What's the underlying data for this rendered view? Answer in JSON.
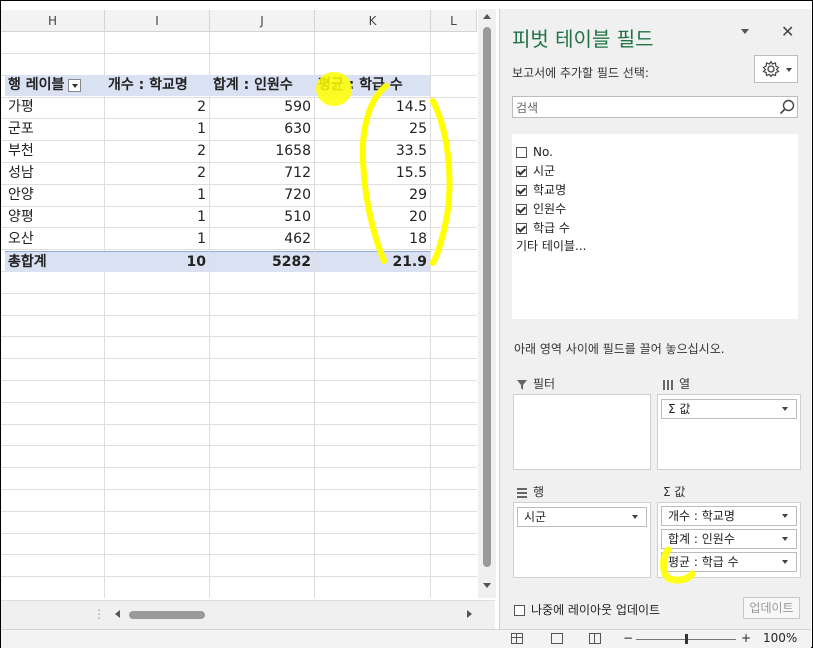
{
  "sheet": {
    "columns": [
      "H",
      "I",
      "J",
      "K",
      "L"
    ],
    "pivot_header": {
      "row_label": "행 레이블",
      "col1": "개수 : 학교명",
      "col2": "합계 : 인원수",
      "col3": "평균 : 학급 수"
    },
    "rows": [
      {
        "label": "가평",
        "v1": "2",
        "v2": "590",
        "v3": "14.5"
      },
      {
        "label": "군포",
        "v1": "1",
        "v2": "630",
        "v3": "25"
      },
      {
        "label": "부천",
        "v1": "2",
        "v2": "1658",
        "v3": "33.5"
      },
      {
        "label": "성남",
        "v1": "2",
        "v2": "712",
        "v3": "15.5"
      },
      {
        "label": "안양",
        "v1": "1",
        "v2": "720",
        "v3": "29"
      },
      {
        "label": "양평",
        "v1": "1",
        "v2": "510",
        "v3": "20"
      },
      {
        "label": "오산",
        "v1": "1",
        "v2": "462",
        "v3": "18"
      }
    ],
    "total": {
      "label": "총합계",
      "v1": "10",
      "v2": "5282",
      "v3": "21.9"
    }
  },
  "pane": {
    "title": "피벗 테이블 필드",
    "choose_label": "보고서에 추가할 필드 선택:",
    "search_placeholder": "검색",
    "fields": [
      {
        "label": "No.",
        "checked": false
      },
      {
        "label": "시군",
        "checked": true
      },
      {
        "label": "학교명",
        "checked": true
      },
      {
        "label": "인원수",
        "checked": true
      },
      {
        "label": "학급 수",
        "checked": true
      }
    ],
    "more_tables": "기타 테이블...",
    "drag_note": "아래 영역 사이에 필드를 끌어 놓으십시오.",
    "areas": {
      "filter_label": "필터",
      "columns_label": "열",
      "columns_chip": "Σ 값",
      "rows_label": "행",
      "rows_chip": "시군",
      "values_label": "Σ 값",
      "values_chips": [
        "개수 : 학교명",
        "합계 : 인원수",
        "평균 : 학급 수"
      ]
    },
    "defer_label": "나중에 레이아웃 업데이트",
    "update_label": "업데이트"
  },
  "status": {
    "zoom": "100%"
  },
  "colors": {
    "highlight": "#ffff00",
    "pivot_header": "#d9e1f2",
    "title_green": "#217346"
  }
}
